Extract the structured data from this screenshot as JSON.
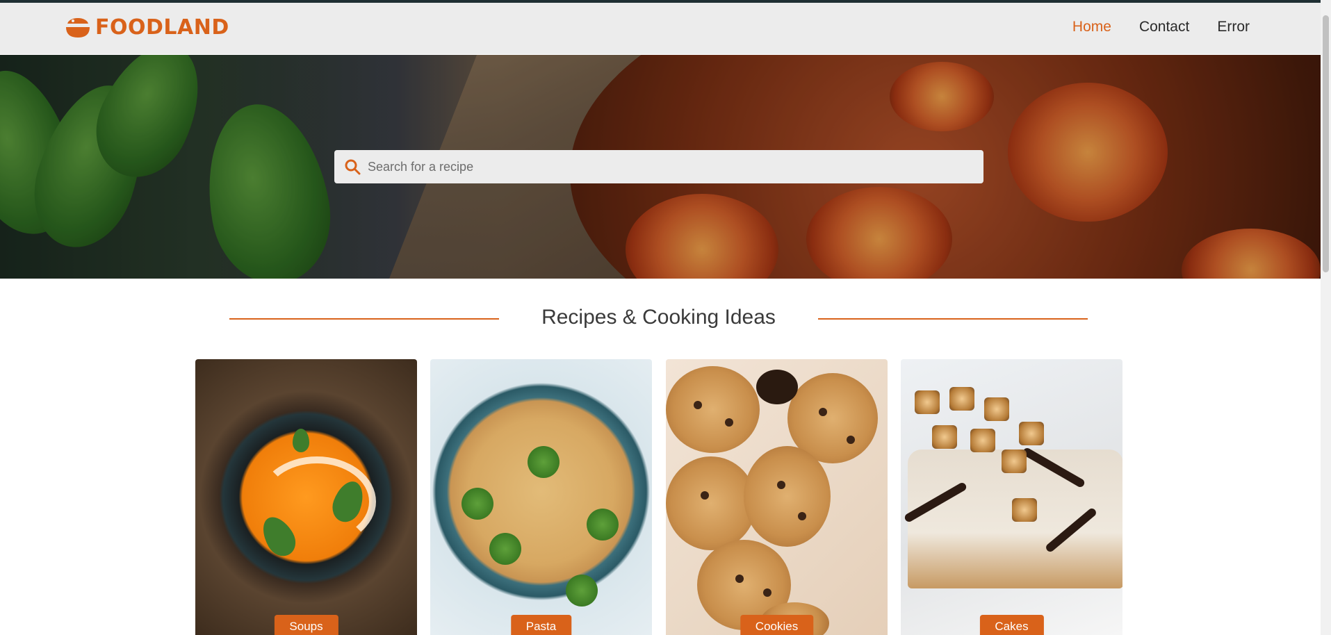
{
  "brand": {
    "name": "FOODLAND"
  },
  "nav": [
    {
      "label": "Home",
      "active": true
    },
    {
      "label": "Contact",
      "active": false
    },
    {
      "label": "Error",
      "active": false
    }
  ],
  "search": {
    "placeholder": "Search for a recipe",
    "value": ""
  },
  "section": {
    "title": "Recipes & Cooking Ideas"
  },
  "categories": [
    {
      "label": "Soups"
    },
    {
      "label": "Pasta"
    },
    {
      "label": "Cookies"
    },
    {
      "label": "Cakes"
    }
  ],
  "colors": {
    "accent": "#d9621a",
    "navbar_bg": "#ececec",
    "text": "#2a2a2a"
  },
  "icons": {
    "brand": "food-bowl-icon",
    "search": "search-icon"
  }
}
